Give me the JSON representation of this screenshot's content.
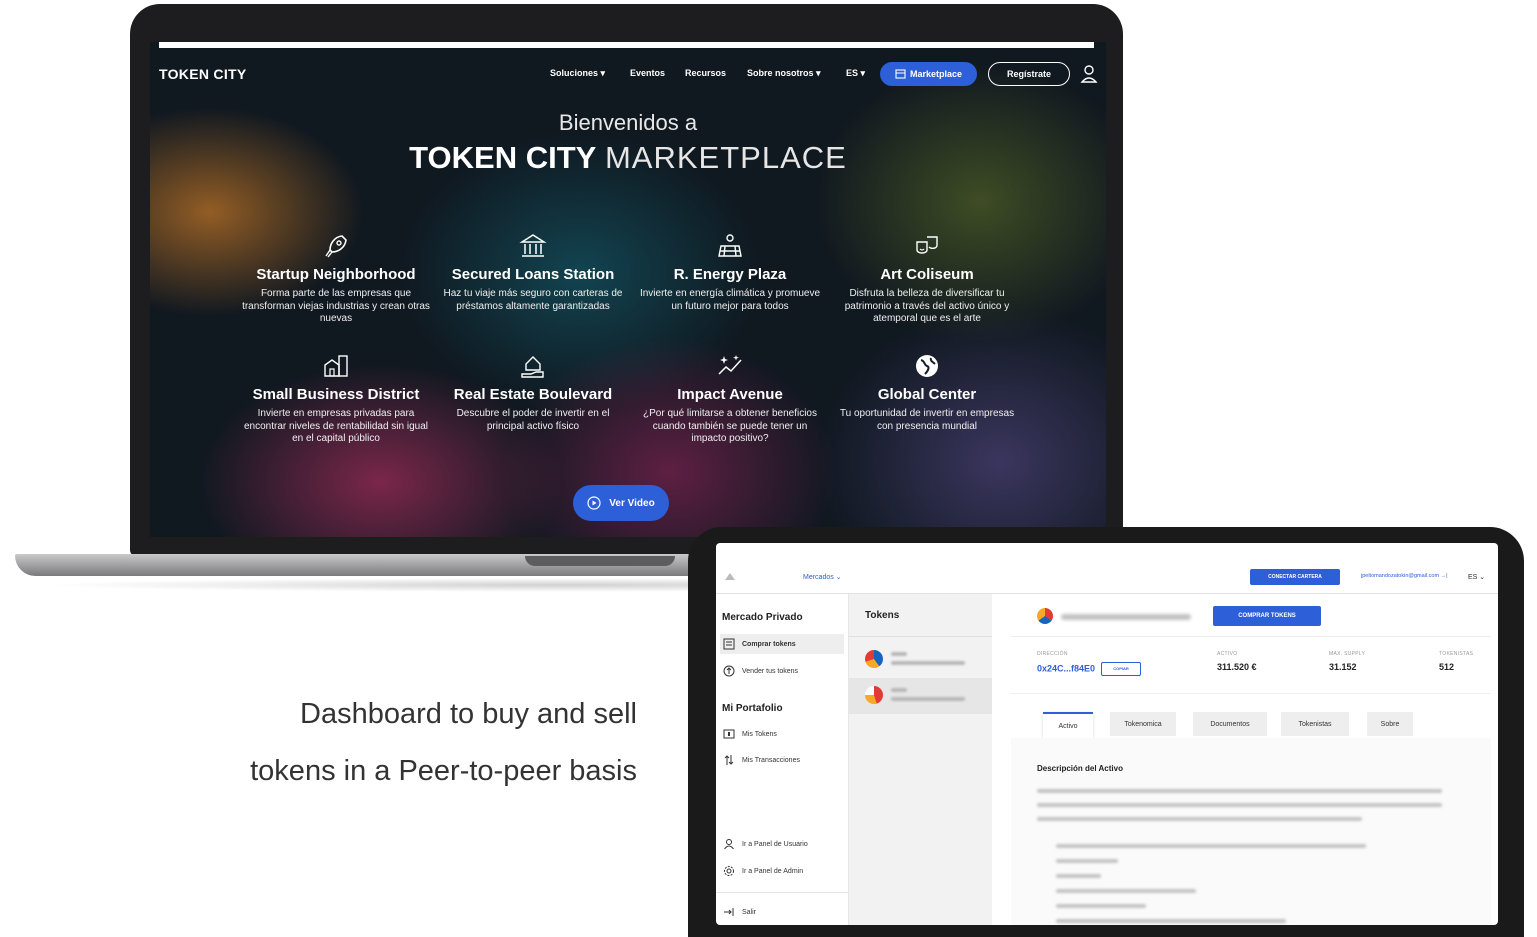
{
  "laptop": {
    "logo": "TOKEN CITY",
    "nav": {
      "soluciones": "Soluciones",
      "eventos": "Eventos",
      "recursos": "Recursos",
      "sobre_nosotros": "Sobre nosotros",
      "lang": "ES",
      "marketplace": "Marketplace",
      "register": "Regístrate"
    },
    "welcome_line": "Bienvenidos a",
    "headline_bold": "TOKEN CITY",
    "headline_light": "MARKETPLACE",
    "districts": [
      {
        "title": "Startup Neighborhood",
        "desc": "Forma parte de las empresas que transforman viejas industrias y crean otras nuevas",
        "icon": "rocket-icon"
      },
      {
        "title": "Secured Loans Station",
        "desc": "Haz tu viaje más seguro con carteras de préstamos altamente garantizadas",
        "icon": "bank-icon"
      },
      {
        "title": "R. Energy Plaza",
        "desc": "Invierte en energía climática y promueve un futuro mejor para todos",
        "icon": "solar-panel-icon"
      },
      {
        "title": "Art Coliseum",
        "desc": "Disfruta la belleza de diversificar tu patrimonio a través del activo único y atemporal que es el arte",
        "icon": "theater-masks-icon"
      },
      {
        "title": "Small Business District",
        "desc": "Invierte en empresas privadas para encontrar niveles de rentabilidad sin igual en el capital público",
        "icon": "buildings-icon"
      },
      {
        "title": "Real Estate Boulevard",
        "desc": "Descubre el poder de invertir en el principal activo físico",
        "icon": "house-hand-icon"
      },
      {
        "title": "Impact Avenue",
        "desc": "¿Por qué limitarse a obtener beneficios cuando también se puede tener un impacto positivo?",
        "icon": "sparkle-chart-icon"
      },
      {
        "title": "Global Center",
        "desc": "Tu oportunidad de invertir en empresas con presencia mundial",
        "icon": "globe-icon"
      }
    ],
    "video_button": "Ver Video",
    "accent_color": "#2d5fd8"
  },
  "caption": {
    "line1": "Dashboard  to buy  and sell",
    "line2": "tokens in a Peer-to-peer basis"
  },
  "tablet": {
    "mercados": "Mercados ⌄",
    "connect_wallet": "CONECTAR CARTERA",
    "email": "jpeltomandozatokin@gmail.com",
    "lang": "ES",
    "sidebar": {
      "private_market": "Mercado Privado",
      "buy_tokens": "Comprar tokens",
      "sell_tokens": "Vender tus tokens",
      "my_portfolio": "Mi Portafolio",
      "my_tokens": "Mis Tokens",
      "my_transactions": "Mis Transacciones",
      "user_panel": "Ir a Panel de Usuario",
      "admin_panel": "Ir a Panel de Admin",
      "logout": "Salir"
    },
    "tokens_title": "Tokens",
    "buy_button": "COMPRAR TOKENS",
    "stats": {
      "address_label": "DIRECCIÓN",
      "address_value": "0x24C...f84E0",
      "copy": "COPIAR",
      "asset_label": "ACTIVO",
      "asset_value": "311.520 €",
      "supply_label": "MAX. SUPPLY",
      "supply_value": "31.152",
      "holders_label": "TOKENISTAS",
      "holders_value": "512"
    },
    "tabs": [
      "Activo",
      "Tokenomica",
      "Documentos",
      "Tokenistas",
      "Sobre"
    ],
    "description_title": "Descripción del Activo"
  }
}
